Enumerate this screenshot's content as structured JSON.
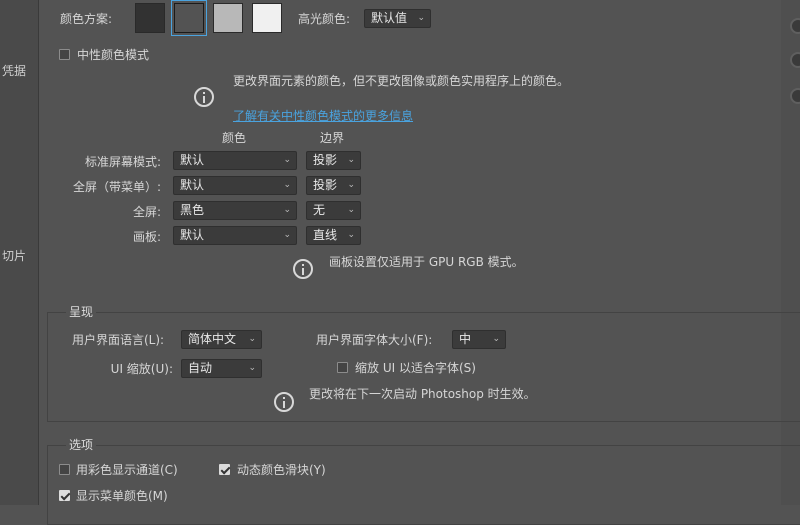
{
  "sidebar": {
    "items": [
      {
        "label": "凭据"
      },
      {
        "label": "切片"
      }
    ]
  },
  "appearance": {
    "color_scheme_label": "颜色方案:",
    "swatches": [
      {
        "color": "#323232",
        "selected": false
      },
      {
        "color": "#535353",
        "selected": true
      },
      {
        "color": "#b8b8b8",
        "selected": false
      },
      {
        "color": "#f0f0f0",
        "selected": false
      }
    ],
    "highlight_label": "高光颜色:",
    "highlight_value": "默认值",
    "neutral_mode_label": "中性颜色模式",
    "neutral_mode_checked": false,
    "neutral_desc": "更改界面元素的颜色，但不更改图像或颜色实用程序上的颜色。",
    "learn_more": "了解有关中性颜色模式的更多信息",
    "col_color": "颜色",
    "col_border": "边界",
    "rows": [
      {
        "label": "标准屏幕模式:",
        "color": "默认",
        "border": "投影"
      },
      {
        "label": "全屏（带菜单）:",
        "color": "默认",
        "border": "投影"
      },
      {
        "label": "全屏:",
        "color": "黑色",
        "border": "无"
      },
      {
        "label": "画板:",
        "color": "默认",
        "border": "直线"
      }
    ],
    "artboard_note": "画板设置仅适用于 GPU RGB 模式。"
  },
  "presentation": {
    "title": "呈现",
    "ui_language_label": "用户界面语言(L):",
    "ui_language_value": "简体中文",
    "ui_font_size_label": "用户界面字体大小(F):",
    "ui_font_size_value": "中",
    "ui_scale_label": "UI 缩放(U):",
    "ui_scale_value": "自动",
    "scale_to_font_label": "缩放 UI 以适合字体(S)",
    "scale_to_font_checked": false,
    "restart_note": "更改将在下一次启动 Photoshop 时生效。"
  },
  "options": {
    "title": "选项",
    "color_channels_label": "用彩色显示通道(C)",
    "color_channels_checked": false,
    "dynamic_sliders_label": "动态颜色滑块(Y)",
    "dynamic_sliders_checked": true,
    "menu_colors_label": "显示菜单颜色(M)",
    "menu_colors_checked": true
  }
}
